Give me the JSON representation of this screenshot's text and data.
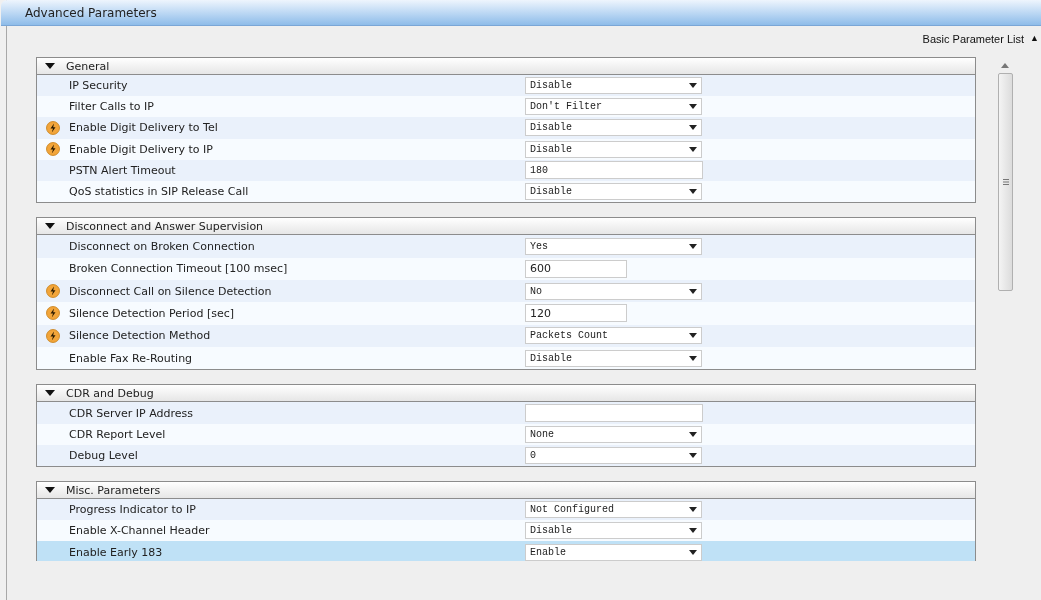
{
  "window": {
    "title": "Advanced Parameters"
  },
  "basic_list_link": {
    "label": "Basic Parameter List",
    "icon": "▲"
  },
  "sections": [
    {
      "title": "General",
      "expanded": true,
      "rows": [
        {
          "label": "IP Security",
          "flag": false,
          "kind": "select",
          "value": "Disable",
          "highlighted": false
        },
        {
          "label": "Filter Calls to IP",
          "flag": false,
          "kind": "select",
          "value": "Don't Filter",
          "highlighted": false
        },
        {
          "label": "Enable Digit Delivery to Tel",
          "flag": true,
          "kind": "select",
          "value": "Disable",
          "highlighted": false
        },
        {
          "label": "Enable Digit Delivery to IP",
          "flag": true,
          "kind": "select",
          "value": "Disable",
          "highlighted": false
        },
        {
          "label": "PSTN Alert Timeout",
          "flag": false,
          "kind": "text",
          "value": "180",
          "highlighted": false
        },
        {
          "label": "QoS statistics in SIP Release Call",
          "flag": false,
          "kind": "select",
          "value": "Disable",
          "highlighted": false
        }
      ]
    },
    {
      "title": "Disconnect and Answer Supervision",
      "expanded": true,
      "rows": [
        {
          "label": "Disconnect on Broken Connection",
          "flag": false,
          "kind": "select",
          "value": "Yes",
          "highlighted": false
        },
        {
          "label": "Broken Connection Timeout [100 msec]",
          "flag": false,
          "kind": "number",
          "value": "600",
          "highlighted": false
        },
        {
          "label": "Disconnect Call on Silence Detection",
          "flag": true,
          "kind": "select",
          "value": "No",
          "highlighted": false
        },
        {
          "label": "Silence Detection Period [sec]",
          "flag": true,
          "kind": "number",
          "value": "120",
          "highlighted": false
        },
        {
          "label": "Silence Detection Method",
          "flag": true,
          "kind": "select",
          "value": "Packets Count",
          "highlighted": false
        },
        {
          "label": "Enable Fax Re-Routing",
          "flag": false,
          "kind": "select",
          "value": "Disable",
          "highlighted": false
        }
      ]
    },
    {
      "title": "CDR and Debug",
      "expanded": true,
      "rows": [
        {
          "label": "CDR Server IP Address",
          "flag": false,
          "kind": "text",
          "highlighted": false
        },
        {
          "label": "CDR Report Level",
          "flag": false,
          "kind": "select",
          "value": "None",
          "highlighted": false
        },
        {
          "label": "Debug Level",
          "flag": false,
          "kind": "select",
          "value": "0",
          "highlighted": false
        }
      ]
    },
    {
      "title": "Misc. Parameters",
      "expanded": true,
      "rows": [
        {
          "label": "Progress Indicator to IP",
          "flag": false,
          "kind": "select",
          "value": "Not Configured",
          "highlighted": false
        },
        {
          "label": "Enable X-Channel Header",
          "flag": false,
          "kind": "select",
          "value": "Disable",
          "highlighted": false
        },
        {
          "label": "Enable Early 183",
          "flag": false,
          "kind": "select",
          "value": "Enable",
          "highlighted": true
        }
      ]
    }
  ]
}
